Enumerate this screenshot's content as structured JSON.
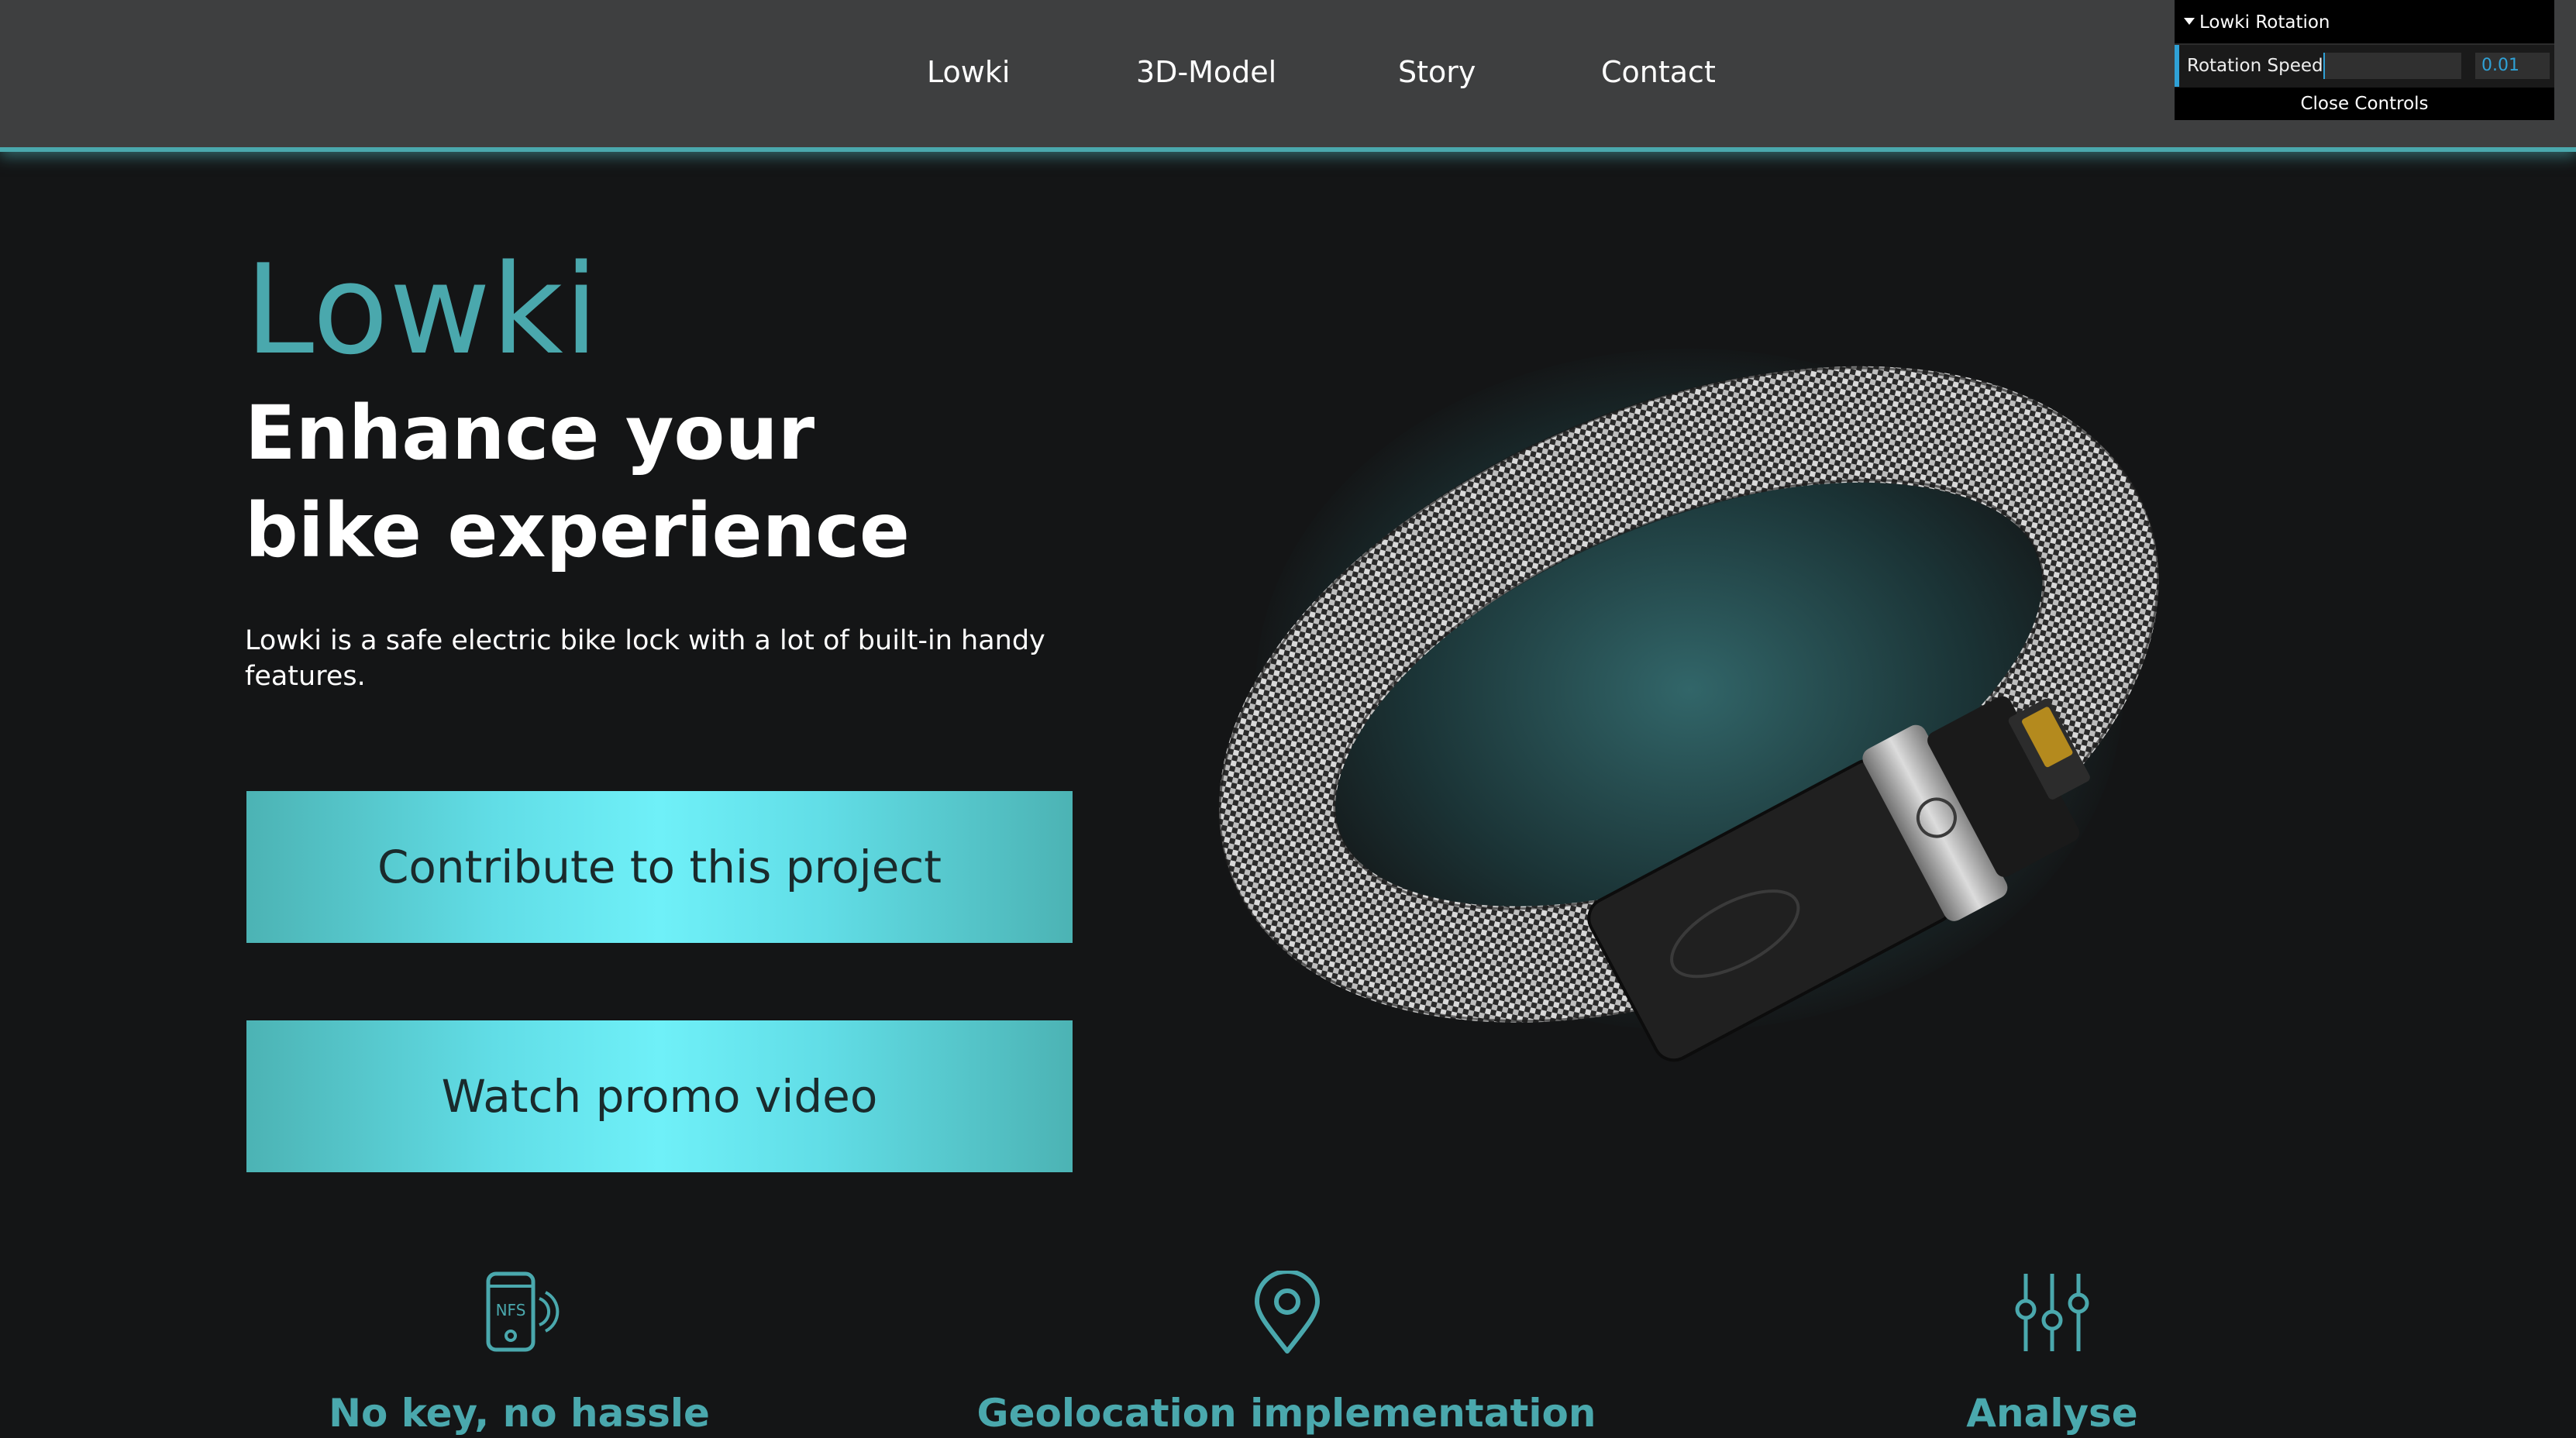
{
  "nav": {
    "items": [
      {
        "label": "Lowki"
      },
      {
        "label": "3D-Model"
      },
      {
        "label": "Story"
      },
      {
        "label": "Contact"
      }
    ]
  },
  "gui": {
    "folder_title": "Lowki Rotation",
    "param_label": "Rotation Speed",
    "param_value": "0.01",
    "close_label": "Close Controls"
  },
  "hero": {
    "title": "Lowki",
    "subtitle": "Enhance your bike experience",
    "description": "Lowki is a safe electric bike lock with a lot of built-in handy features.",
    "primary_button": "Contribute to this project",
    "secondary_button": "Watch promo video"
  },
  "features": [
    {
      "icon": "nfc-phone-icon",
      "icon_text": "NFS",
      "title": "No key, no hassle"
    },
    {
      "icon": "location-pin-icon",
      "title": "Geolocation implementation"
    },
    {
      "icon": "sliders-icon",
      "title": "Analyse"
    }
  ],
  "colors": {
    "accent": "#4aa8ad",
    "background": "#141516",
    "header": "#3e3f40",
    "button_light": "#6ff0f8"
  }
}
